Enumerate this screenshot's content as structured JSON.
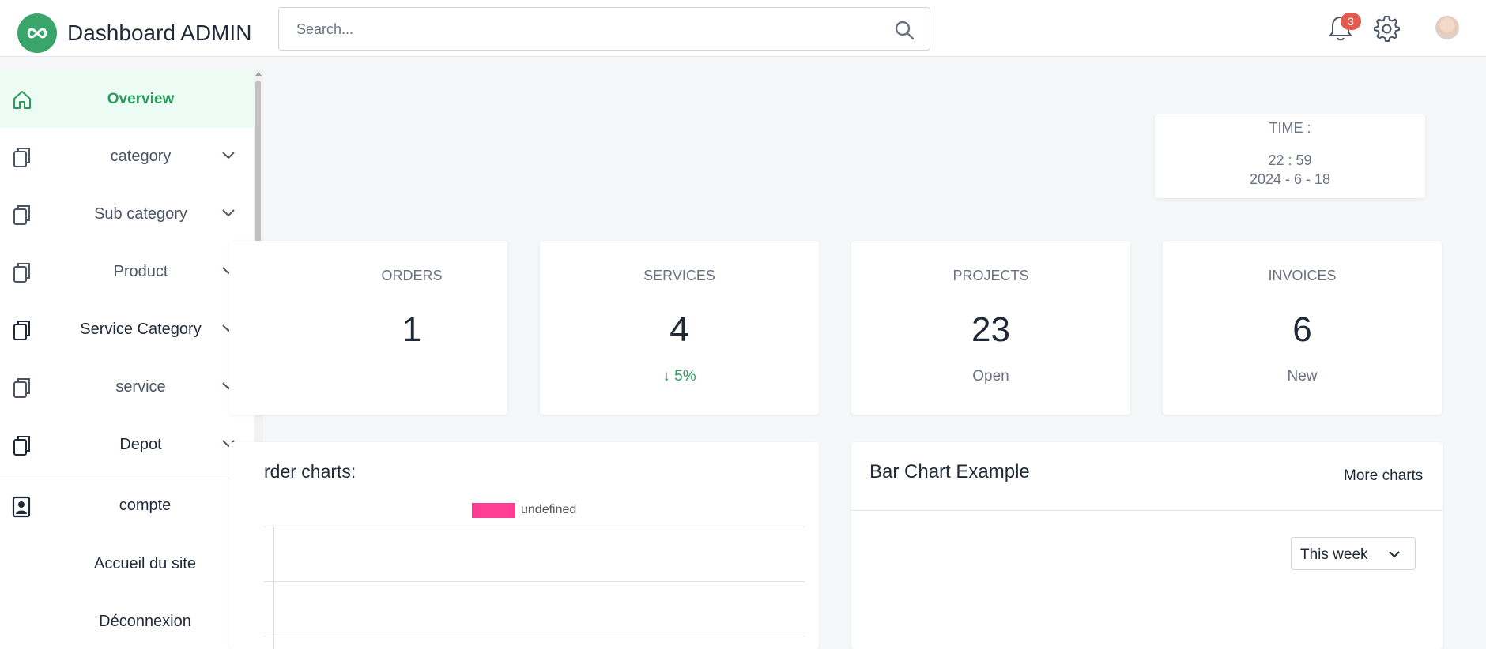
{
  "header": {
    "brand": "Dashboard ADMIN",
    "search_placeholder": "Search...",
    "notifications_count": "3",
    "colors": {
      "brand": "#3aa56a",
      "badge": "#e15b4f"
    }
  },
  "sidebar": {
    "items": [
      {
        "label": "Overview",
        "icon": "home-icon",
        "active": true,
        "expandable": false
      },
      {
        "label": "category",
        "icon": "copy-icon",
        "expandable": true
      },
      {
        "label": "Sub category",
        "icon": "copy-icon",
        "expandable": true
      },
      {
        "label": "Product",
        "icon": "copy-icon",
        "expandable": true
      },
      {
        "label": "Service Category",
        "icon": "copy-icon",
        "expandable": true
      },
      {
        "label": "service",
        "icon": "copy-icon",
        "expandable": true
      },
      {
        "label": "Depot",
        "icon": "copy-icon",
        "expandable": true
      }
    ],
    "footer": [
      {
        "label": "compte",
        "icon": "contact-card-icon"
      },
      {
        "label": "Accueil du site"
      },
      {
        "label": "Déconnexion"
      }
    ],
    "active_color": "#2a9d5c"
  },
  "time_card": {
    "title": "TIME :",
    "clock": "22 : 59",
    "date": "2024 - 6 - 18"
  },
  "stats": [
    {
      "title": "ORDERS",
      "value": "1",
      "sub": ""
    },
    {
      "title": "SERVICES",
      "value": "4",
      "sub": "↓ 5%"
    },
    {
      "title": "PROJECTS",
      "value": "23",
      "sub": "Open"
    },
    {
      "title": "INVOICES",
      "value": "6",
      "sub": "New"
    }
  ],
  "order_chart": {
    "title": "rder charts:",
    "legend": "undefined",
    "legend_color": "#ff3d94"
  },
  "bar_chart_panel": {
    "title": "Bar Chart Example",
    "more_link": "More charts",
    "period_select": "This week"
  }
}
